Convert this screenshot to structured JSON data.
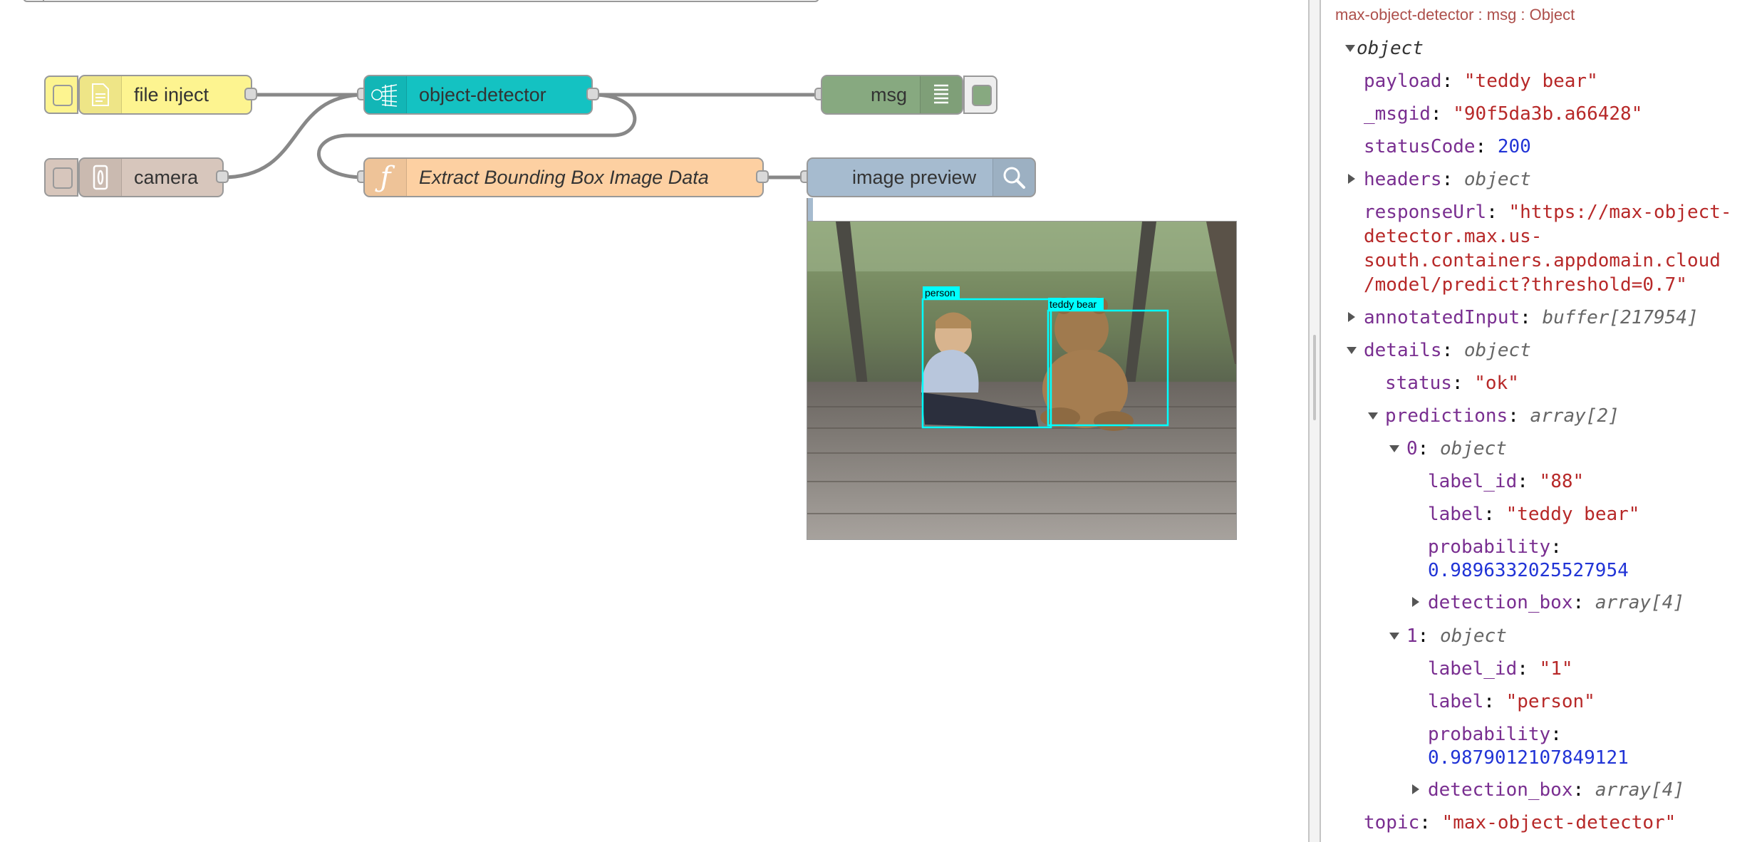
{
  "flow": {
    "nodes": {
      "file_inject": {
        "label": "file inject",
        "color": "#fdf490",
        "icon": "file-icon"
      },
      "camera": {
        "label": "camera",
        "color": "#d7c6bc",
        "icon": "camera-icon"
      },
      "object_detector": {
        "label": "object-detector",
        "color": "#14c2c2",
        "icon": "neural-network-icon"
      },
      "msg": {
        "label": "msg",
        "color": "#87a980",
        "icon": "list-icon"
      },
      "extract": {
        "label": "Extract Bounding Box Image Data",
        "color": "#fdd0a2",
        "icon": "function-icon"
      },
      "image_preview": {
        "label": "image preview",
        "color": "#a6bbcf",
        "icon": "search-icon"
      }
    },
    "preview": {
      "boxes": [
        {
          "label": "person"
        },
        {
          "label": "teddy bear"
        }
      ],
      "box_color": "#00ffff"
    }
  },
  "sidebar": {
    "header": "max-object-detector : msg : Object",
    "root_type": "object",
    "rows": {
      "payload": {
        "key": "payload",
        "value": "\"teddy bear\""
      },
      "msgid": {
        "key": "_msgid",
        "value": "\"90f5da3b.a66428\""
      },
      "statusCode": {
        "key": "statusCode",
        "value": "200"
      },
      "headers": {
        "key": "headers",
        "value": "object"
      },
      "responseUrl": {
        "key": "responseUrl",
        "value_lines": [
          "\"https://max-object-",
          "detector.max.us-",
          "south.containers.appdomain.cloud",
          "/model/predict?threshold=0.7\""
        ]
      },
      "annotatedInput": {
        "key": "annotatedInput",
        "value": "buffer[217954]"
      },
      "details": {
        "key": "details",
        "value": "object"
      },
      "status": {
        "key": "status",
        "value": "\"ok\""
      },
      "predictions": {
        "key": "predictions",
        "value": "array[2]"
      },
      "p0": {
        "key": "0",
        "value": "object"
      },
      "p0_label_id": {
        "key": "label_id",
        "value": "\"88\""
      },
      "p0_label": {
        "key": "label",
        "value": "\"teddy bear\""
      },
      "p0_prob": {
        "key": "probability",
        "value": "0.9896332025527954"
      },
      "p0_box": {
        "key": "detection_box",
        "value": "array[4]"
      },
      "p1": {
        "key": "1",
        "value": "object"
      },
      "p1_label_id": {
        "key": "label_id",
        "value": "\"1\""
      },
      "p1_label": {
        "key": "label",
        "value": "\"person\""
      },
      "p1_prob": {
        "key": "probability",
        "value": "0.9879012107849121"
      },
      "p1_box": {
        "key": "detection_box",
        "value": "array[4]"
      },
      "topic": {
        "key": "topic",
        "value": "\"max-object-detector\""
      }
    }
  }
}
